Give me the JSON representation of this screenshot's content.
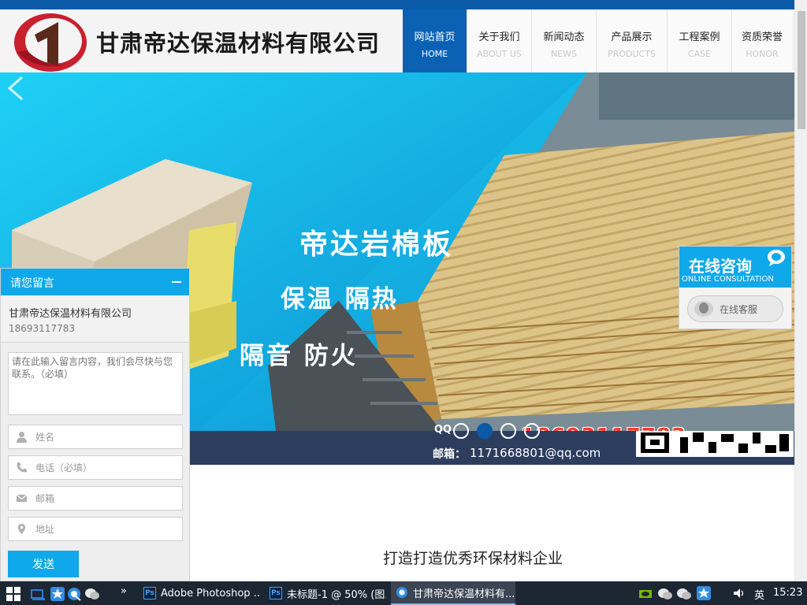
{
  "header": {
    "company_name": "甘肃帝达保温材料有限公司",
    "nav": [
      {
        "cn": "网站首页",
        "en": "HOME"
      },
      {
        "cn": "关于我们",
        "en": "ABOUT US"
      },
      {
        "cn": "新闻动态",
        "en": "NEWS"
      },
      {
        "cn": "产品展示",
        "en": "PRODUCTS"
      },
      {
        "cn": "工程案例",
        "en": "CASE"
      },
      {
        "cn": "资质荣誉",
        "en": "HONOR"
      }
    ]
  },
  "banner": {
    "title": "帝达岩棉板",
    "line1": "保温  隔热",
    "line2": "隔音  防火",
    "phone": "18693117783",
    "slide_count": 4,
    "active_slide": 2
  },
  "contact_strip": {
    "qq_label": "QQ",
    "email_label": "邮箱：",
    "email": "1171668801@qq.com"
  },
  "slogan": "打造打造优秀环保材料企业",
  "message_widget": {
    "title": "请您留言",
    "company": "甘肃帝达保温材料有限公司",
    "phone": "18693117783",
    "content_placeholder": "请在此输入留言内容，我们会尽快与您联系。（必填）",
    "name_placeholder": "姓名",
    "tel_placeholder": "电话（必填）",
    "email_placeholder": "邮箱",
    "address_placeholder": "地址",
    "send_label": "发送"
  },
  "consult_widget": {
    "title": "在线咨询",
    "subtitle": "ONLINE CONSULTATION",
    "button_label": "在线客服"
  },
  "taskbar": {
    "tasks": [
      {
        "label": "Adobe Photoshop ...",
        "icon": "Ps"
      },
      {
        "label": "未标题-1 @ 50% (图...",
        "icon": "Ps"
      },
      {
        "label": "甘肃帝达保温材料有...",
        "icon": "browser"
      }
    ],
    "ime": "英",
    "time": "15:23"
  },
  "colors": {
    "primary": "#0b62b4",
    "widget_blue": "#0fa8ea",
    "contact_strip": "#2c3d5e",
    "phone_red": "#ff3a2a"
  }
}
